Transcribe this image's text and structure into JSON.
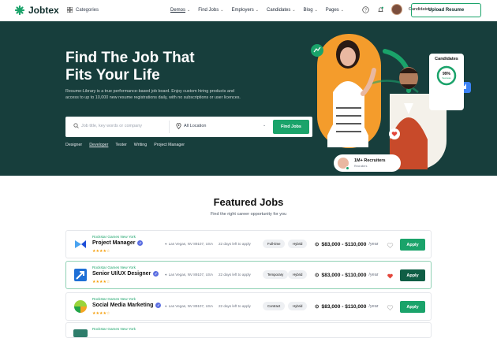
{
  "nav": {
    "logo_text": "Jobtex",
    "categories_label": "Categories",
    "menu": [
      "Demos",
      "Find Jobs",
      "Employers",
      "Candidates",
      "Blog",
      "Pages"
    ],
    "user_label": "Candidates",
    "upload_label": "Upload Resume"
  },
  "hero": {
    "title_line1": "Find The Job That",
    "title_line2": "Fits Your Life",
    "description": "Resume-Library is a true performance-based job board. Enjoy custom hiring products and access to up to 10,000 new resume registrations daily, with no subscriptions or user licences.",
    "search_placeholder": "Job title, key words or company",
    "location_value": "All Location",
    "search_button": "Find Jobs",
    "tags": [
      "Designer",
      "Developer",
      "Tester",
      "Writing",
      "Project Manager"
    ],
    "candidates_card": {
      "title": "Candidates",
      "percent": "99%",
      "percent_value": 0.99,
      "sub": "Success"
    },
    "recruiters_card": {
      "title": "1M+ Recruiters",
      "sub": "Recruiters"
    }
  },
  "featured": {
    "title": "Featured Jobs",
    "subtitle": "Find the right career opportunity for you",
    "jobs": [
      {
        "company": "Rockstar Games New York",
        "title": "Project Manager",
        "stars": "★★★★☆",
        "location": "Las Vegas, NV 89107, USA",
        "time_left": "22 days left to apply",
        "type": "Full-time",
        "mode": "Hybrid",
        "salary": "$83,000 - $110,000",
        "per": "/year",
        "apply": "Apply",
        "favorite": false
      },
      {
        "company": "Rockstar Games New York",
        "title": "Senior UI/UX Designer",
        "stars": "★★★★☆",
        "location": "Las Vegas, NV 89107, USA",
        "time_left": "22 days left to apply",
        "type": "Temporary",
        "mode": "Hybrid",
        "salary": "$83,000 - $110,000",
        "per": "/year",
        "apply": "Apply",
        "favorite": true
      },
      {
        "company": "Rockstar Games New York",
        "title": "Social Media Marketing",
        "stars": "★★★★☆",
        "location": "Las Vegas, NV 89107, USA",
        "time_left": "22 days left to apply",
        "type": "Contract",
        "mode": "Hybrid",
        "salary": "$83,000 - $110,000",
        "per": "/year",
        "apply": "Apply",
        "favorite": false
      }
    ],
    "partial_company": "Rockstar Games New York"
  },
  "colors": {
    "brand": "#1aa36a",
    "hero_bg": "#173e3c",
    "accent_orange": "#f49c2c"
  }
}
